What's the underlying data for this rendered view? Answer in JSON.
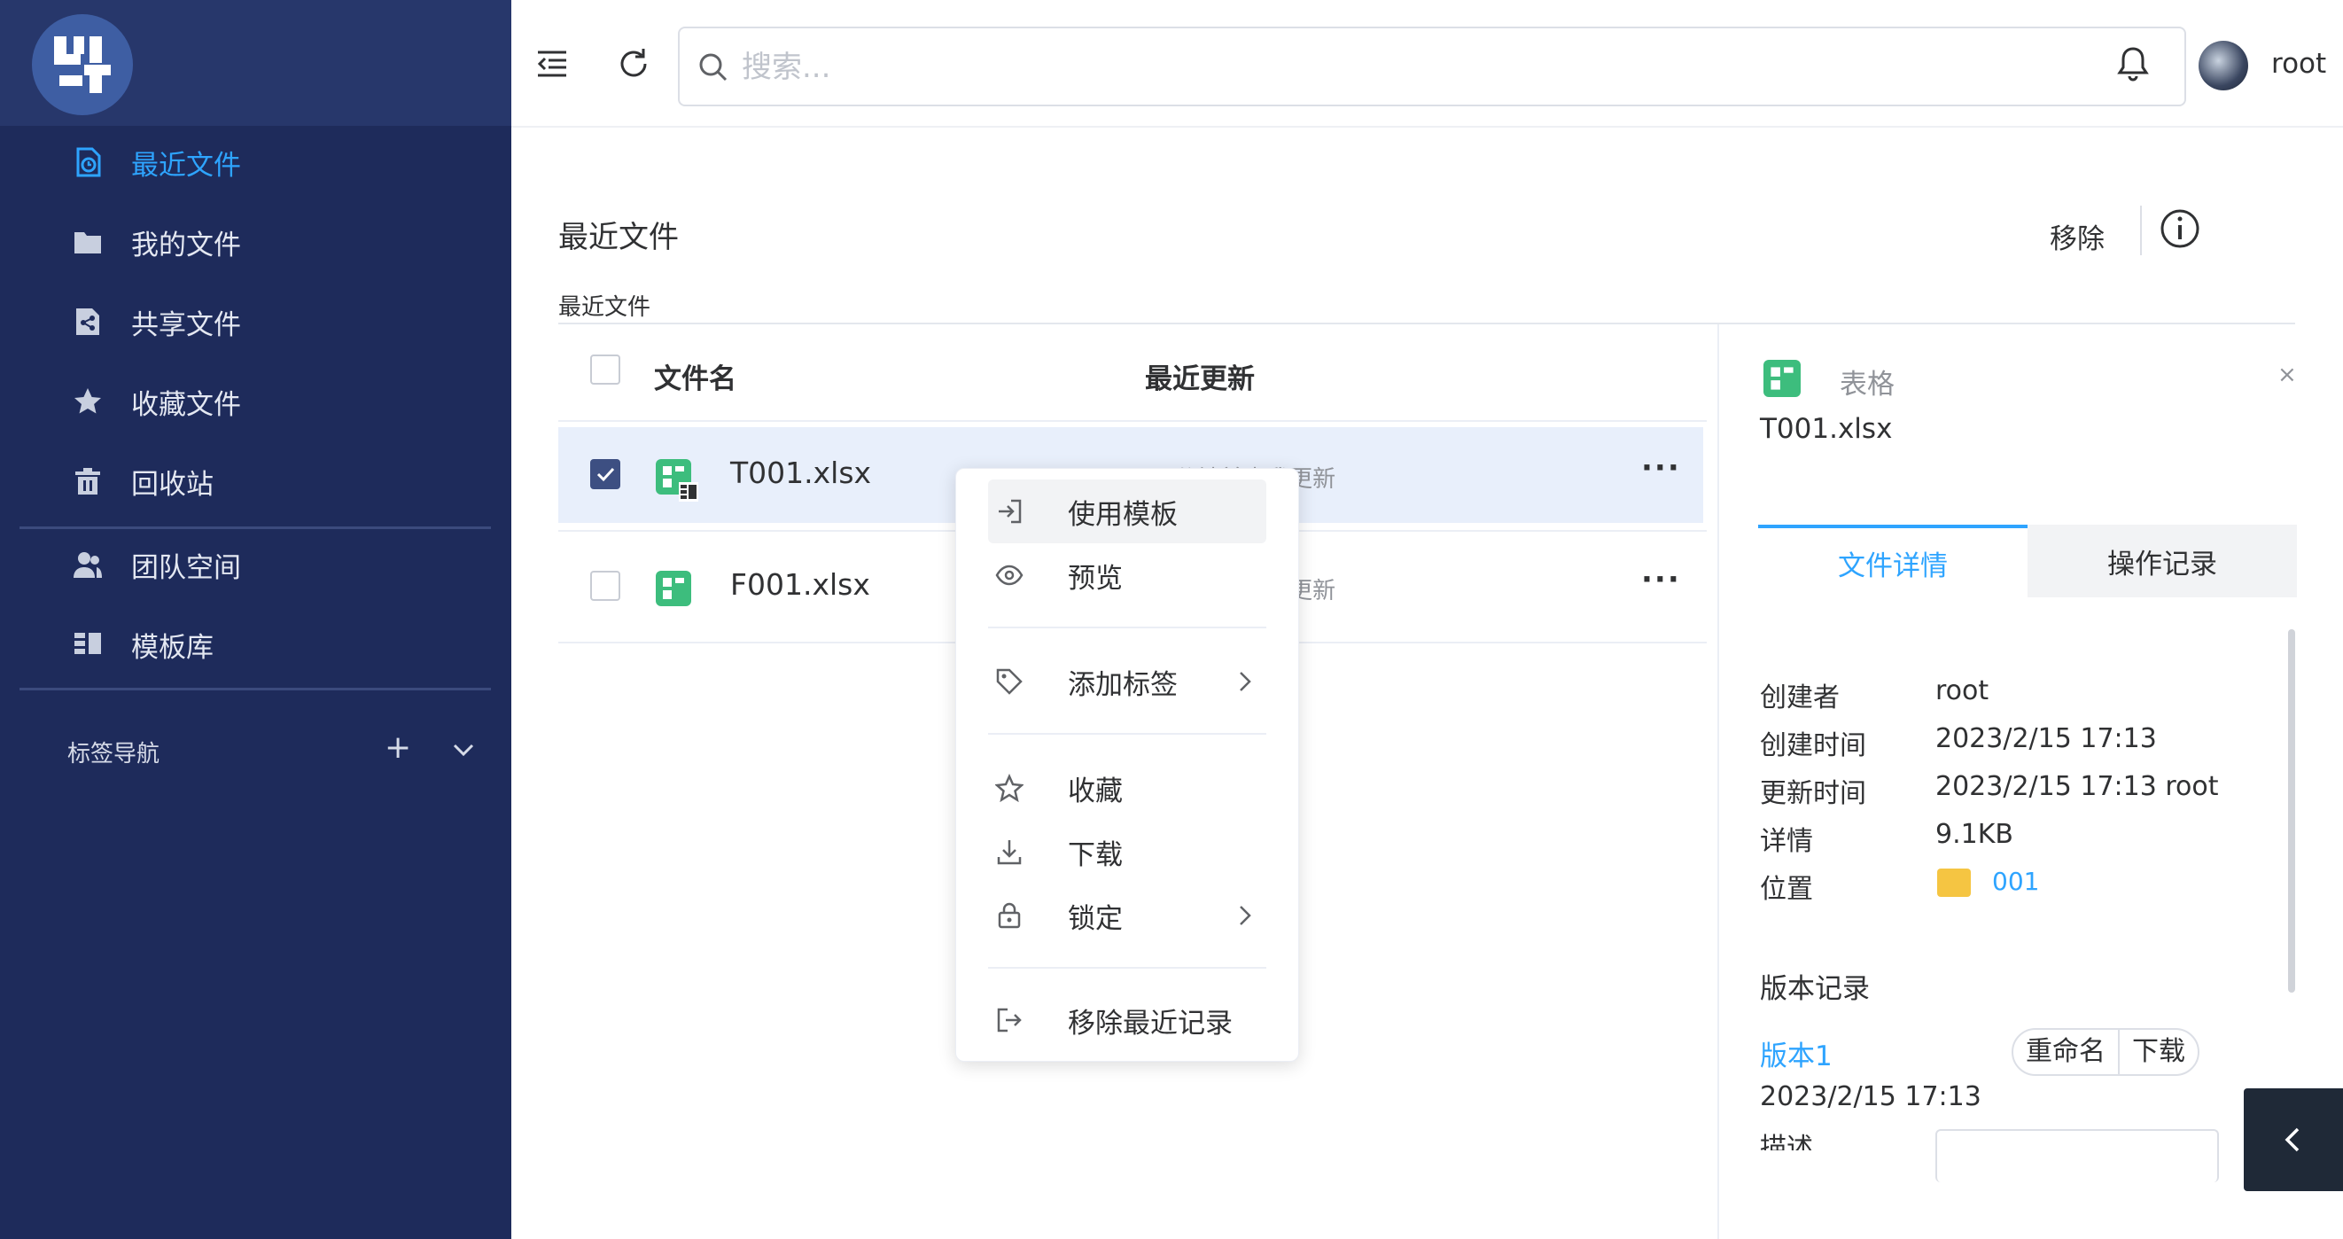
{
  "sidebar": {
    "items": [
      {
        "label": "最近文件",
        "icon": "recent-file-icon"
      },
      {
        "label": "我的文件",
        "icon": "folder-icon"
      },
      {
        "label": "共享文件",
        "icon": "share-file-icon"
      },
      {
        "label": "收藏文件",
        "icon": "star-icon"
      },
      {
        "label": "回收站",
        "icon": "trash-icon"
      },
      {
        "label": "团队空间",
        "icon": "team-icon"
      },
      {
        "label": "模板库",
        "icon": "template-icon"
      }
    ],
    "tag_nav_label": "标签导航",
    "tag_add": "+",
    "active_color": "#2ea4ff",
    "bg_color": "#1e2b5b"
  },
  "header": {
    "search_placeholder": "搜索...",
    "username": "root"
  },
  "main": {
    "title": "最近文件",
    "remove_label": "移除",
    "breadcrumb": "最近文件",
    "columns": {
      "name": "文件名",
      "updated": "最近更新"
    },
    "rows": [
      {
        "name": "T001.xlsx",
        "updated": "12分钟前由我更新",
        "selected": true
      },
      {
        "name": "F001.xlsx",
        "updated": "12分钟前由我更新",
        "selected": false
      }
    ],
    "more": "···"
  },
  "context_menu": {
    "items": [
      {
        "label": "使用模板"
      },
      {
        "label": "预览"
      },
      {
        "label": "添加标签"
      },
      {
        "label": "收藏"
      },
      {
        "label": "下载"
      },
      {
        "label": "锁定"
      },
      {
        "label": "移除最近记录"
      }
    ]
  },
  "panel": {
    "type_label": "表格",
    "close": "×",
    "file_name": "T001.xlsx",
    "tabs": [
      {
        "label": "文件详情"
      },
      {
        "label": "操作记录"
      }
    ],
    "details": [
      {
        "key": "创建者",
        "value": "root"
      },
      {
        "key": "创建时间",
        "value": "2023/2/15 17:13"
      },
      {
        "key": "更新时间",
        "value": "2023/2/15 17:13 root"
      },
      {
        "key": "详情",
        "value": "9.1KB"
      },
      {
        "key": "位置",
        "value": "001"
      }
    ],
    "version_title": "版本记录",
    "version": {
      "name": "版本1",
      "date": "2023/2/15 17:13",
      "desc_label": "描述",
      "rename": "重命名",
      "download": "下载"
    }
  }
}
